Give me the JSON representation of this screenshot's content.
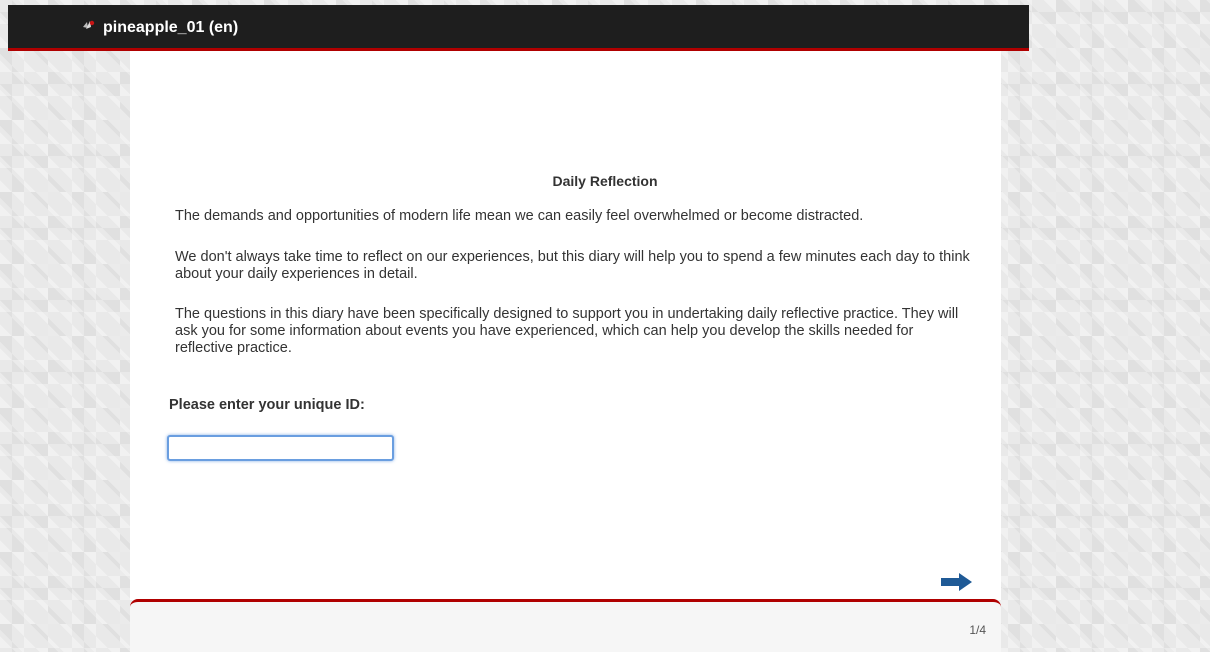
{
  "header": {
    "title": "pineapple_01 (en)",
    "logo_icon": "pineapple-logo-icon",
    "accent_color": "#b00000",
    "bar_color": "#1e1e1e"
  },
  "content": {
    "heading": "Daily Reflection",
    "paragraphs": [
      "The demands and opportunities of modern life mean we can easily feel overwhelmed or become distracted.",
      "We don't always take time to reflect on our experiences, but this diary will help you to spend a few minutes each day to think about your daily experiences in detail.",
      "The questions in this diary have been specifically designed to support you in undertaking daily reflective practice. They will ask you for some information about events you have experienced, which can help you develop the skills needed for reflective practice."
    ],
    "id_label": "Please enter your unique ID:",
    "id_value": ""
  },
  "navigation": {
    "next_icon": "right-arrow-icon",
    "next_color": "#1f5a96"
  },
  "footer": {
    "page_indicator": "1/4"
  }
}
